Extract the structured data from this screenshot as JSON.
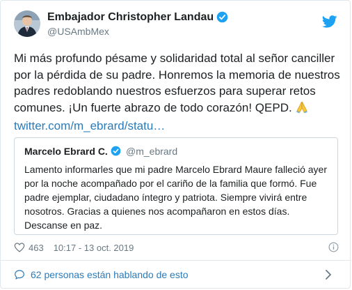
{
  "author": {
    "name": "Embajador Christopher Landau",
    "handle": "@USAmbMex"
  },
  "tweet": {
    "text": "Mi más profundo pésame y solidaridad total al señor canciller por la pérdida de su padre. Honremos la memoria de nuestros padres redoblando nuestros esfuerzos para superar retos comunes. ¡Un fuerte abrazo de todo corazón!  QEPD. ",
    "emoji": "folded-hands-emoji",
    "link": "twitter.com/m_ebrard/statu…"
  },
  "quoted": {
    "name": "Marcelo Ebrard C.",
    "handle": "@m_ebrard",
    "text": "Lamento informarles que mi padre Marcelo Ebrard Maure falleció ayer por la noche acompañado por el cariño de la familia que formó. Fue padre ejemplar, ciudadano íntegro y patriota. Siempre vivirá entre nosotros. Gracias a quienes nos acompañaron en estos días. Descanse en paz."
  },
  "footer": {
    "likes": "463",
    "timestamp": "10:17 - 13 oct. 2019",
    "talking": "62 personas están hablando de esto"
  },
  "icons": {
    "verified": "verified-badge-icon",
    "twitter": "twitter-bird-icon",
    "heart": "heart-icon",
    "info": "info-icon",
    "bubble": "speech-bubble-icon",
    "chevron": "chevron-right-icon"
  },
  "colors": {
    "link": "#2b7bb9",
    "verified": "#1da1f2",
    "muted": "#697882",
    "text": "#1c2022",
    "border": "#e1e8ed"
  }
}
